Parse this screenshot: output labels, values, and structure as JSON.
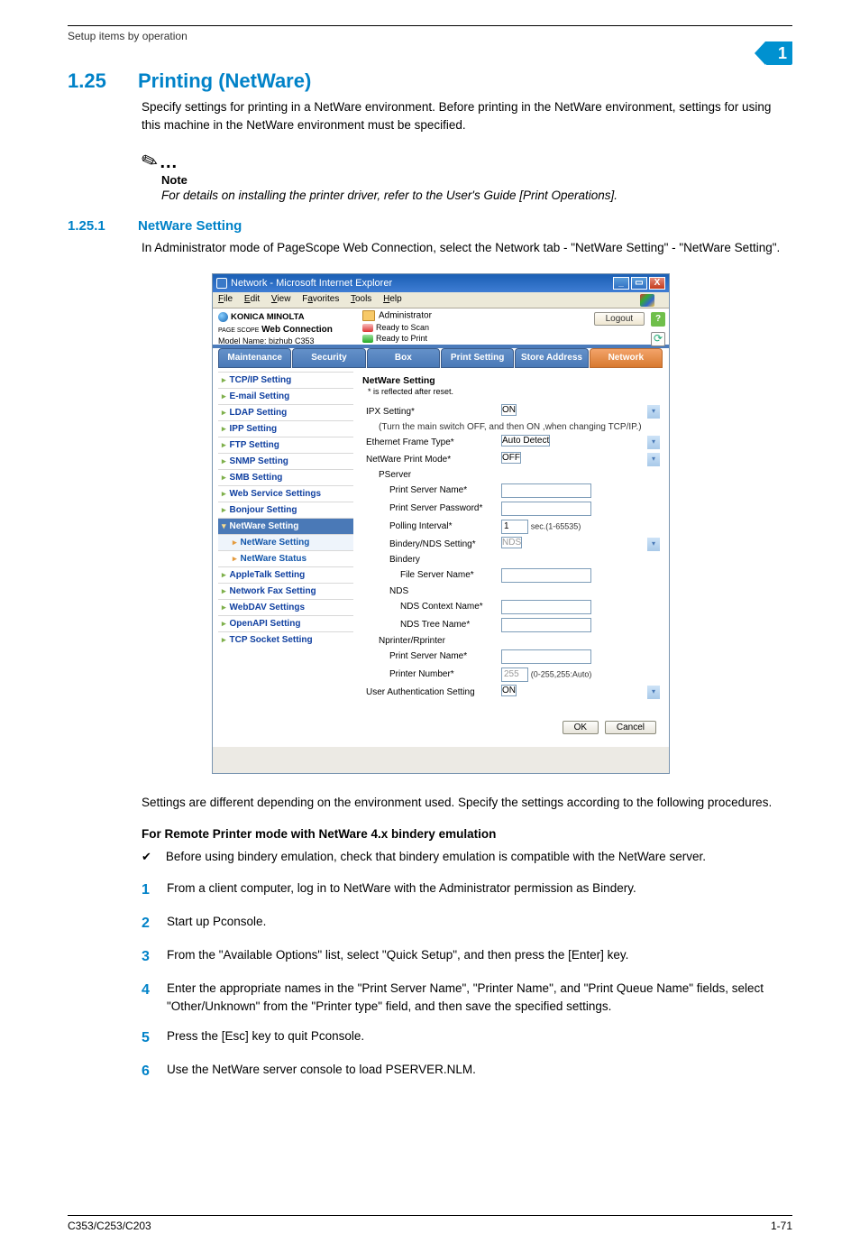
{
  "page": {
    "header_breadcrumb": "Setup items by operation",
    "chapter_badge": "1",
    "footer_model": "C353/C253/C203",
    "footer_page": "1-71"
  },
  "sec1": {
    "num": "1.25",
    "title": "Printing (NetWare)",
    "para": "Specify settings for printing in a NetWare environment. Before printing in the NetWare environment, settings for using this machine in the NetWare environment must be specified."
  },
  "note": {
    "label": "Note",
    "text": "For details on installing the printer driver, refer to the User's Guide [Print Operations]."
  },
  "sec2": {
    "num": "1.25.1",
    "title": "NetWare Setting",
    "para": "In Administrator mode of PageScope Web Connection, select the Network tab - \"NetWare Setting\" - \"NetWare Setting\"."
  },
  "screenshot": {
    "window_title": "Network - Microsoft Internet Explorer",
    "menu": {
      "file": "File",
      "edit": "Edit",
      "view": "View",
      "favorites": "Favorites",
      "tools": "Tools",
      "help": "Help"
    },
    "brand": "KONICA MINOLTA",
    "pagescope_prefix": "PAGE SCOPE",
    "pagescope": "Web Connection",
    "model": "Model Name: bizhub C353",
    "mode": "Administrator",
    "status_scan": "Ready to Scan",
    "status_print": "Ready to Print",
    "logout": "Logout",
    "help": "?",
    "tabs": {
      "maintenance": "Maintenance",
      "security": "Security",
      "box": "Box",
      "print": "Print Setting",
      "store": "Store Address",
      "network": "Network"
    },
    "side": {
      "tcpip": "TCP/IP Setting",
      "email": "E-mail Setting",
      "ldap": "LDAP Setting",
      "ipp": "IPP Setting",
      "ftp": "FTP Setting",
      "snmp": "SNMP Setting",
      "smb": "SMB Setting",
      "webservice": "Web Service Settings",
      "bonjour": "Bonjour Setting",
      "netware": "NetWare Setting",
      "netware_setting": "NetWare Setting",
      "netware_status": "NetWare Status",
      "appletalk": "AppleTalk Setting",
      "netfax": "Network Fax Setting",
      "webdav": "WebDAV Settings",
      "openapi": "OpenAPI Setting",
      "tcpsocket": "TCP Socket Setting"
    },
    "panel": {
      "title": "NetWare Setting",
      "reset_note": "* is reflected after reset.",
      "ipx": "IPX Setting*",
      "ipx_val": "ON",
      "ipx_hint": "(Turn the main switch OFF, and then ON ,when changing TCP/IP.)",
      "frame": "Ethernet Frame Type*",
      "frame_val": "Auto Detect",
      "mode": "NetWare Print Mode*",
      "mode_val": "OFF",
      "pserver": "PServer",
      "psname": "Print Server Name*",
      "pspass": "Print Server Password*",
      "poll": "Polling Interval*",
      "poll_val": "1",
      "poll_unit": "sec.(1-65535)",
      "bnds": "Bindery/NDS Setting*",
      "bnds_val": "NDS",
      "bindery": "Bindery",
      "fsname": "File Server Name*",
      "nds": "NDS",
      "ndsctx": "NDS Context Name*",
      "ndstree": "NDS Tree Name*",
      "nrp": "Nprinter/Rprinter",
      "psname2": "Print Server Name*",
      "prnum": "Printer Number*",
      "prnum_val": "255",
      "prnum_hint": "(0-255,255:Auto)",
      "uauth": "User Authentication Setting",
      "uauth_val": "ON",
      "ok": "OK",
      "cancel": "Cancel"
    }
  },
  "para2": "Settings are different depending on the environment used. Specify the settings according to the following procedures.",
  "subhead": "For Remote Printer mode with NetWare 4.x bindery emulation",
  "checkline": "Before using bindery emulation, check that bindery emulation is compatible with the NetWare server.",
  "steps": {
    "s1": "From a client computer, log in to NetWare with the Administrator permission as Bindery.",
    "s2": "Start up Pconsole.",
    "s3": "From the \"Available Options\" list, select \"Quick Setup\", and then press the [Enter] key.",
    "s4": "Enter the appropriate names in the \"Print Server Name\", \"Printer Name\", and \"Print Queue Name\" fields, select \"Other/Unknown\" from the \"Printer type\" field, and then save the specified settings.",
    "s5": "Press the [Esc] key to quit Pconsole.",
    "s6": "Use the NetWare server console to load PSERVER.NLM."
  }
}
